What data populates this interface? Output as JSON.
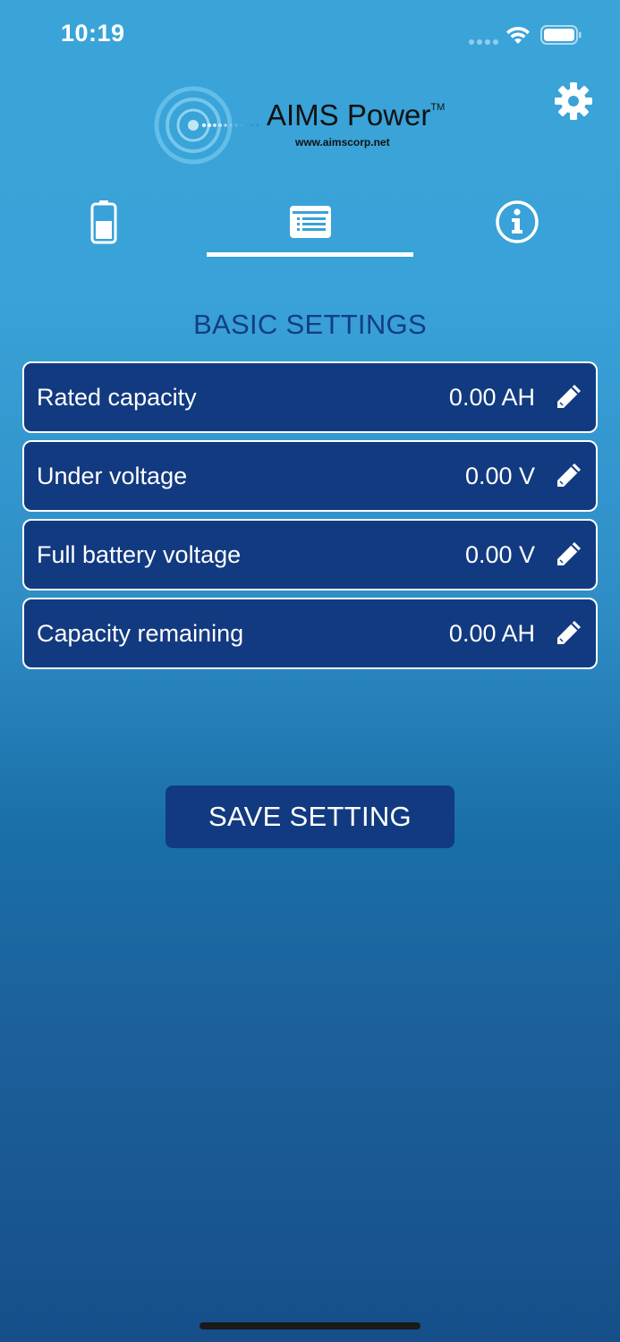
{
  "status_bar": {
    "time": "10:19"
  },
  "logo": {
    "brand": "AIMS Power",
    "trademark": "TM",
    "url": "www.aimscorp.net"
  },
  "tabs": [
    {
      "icon": "battery-icon",
      "selected": false
    },
    {
      "icon": "list-icon",
      "selected": true
    },
    {
      "icon": "info-icon",
      "selected": false
    }
  ],
  "section_title": "BASIC SETTINGS",
  "settings": [
    {
      "label": "Rated capacity",
      "value": "0.00 AH"
    },
    {
      "label": "Under voltage",
      "value": "0.00 V"
    },
    {
      "label": "Full battery voltage",
      "value": "0.00 V"
    },
    {
      "label": "Capacity remaining",
      "value": "0.00 AH"
    }
  ],
  "save_button_label": "SAVE SETTING",
  "colors": {
    "background_top": "#3aa4d9",
    "background_bottom": "#164f8a",
    "row_fill": "#123a80",
    "title_text": "#123d86"
  }
}
